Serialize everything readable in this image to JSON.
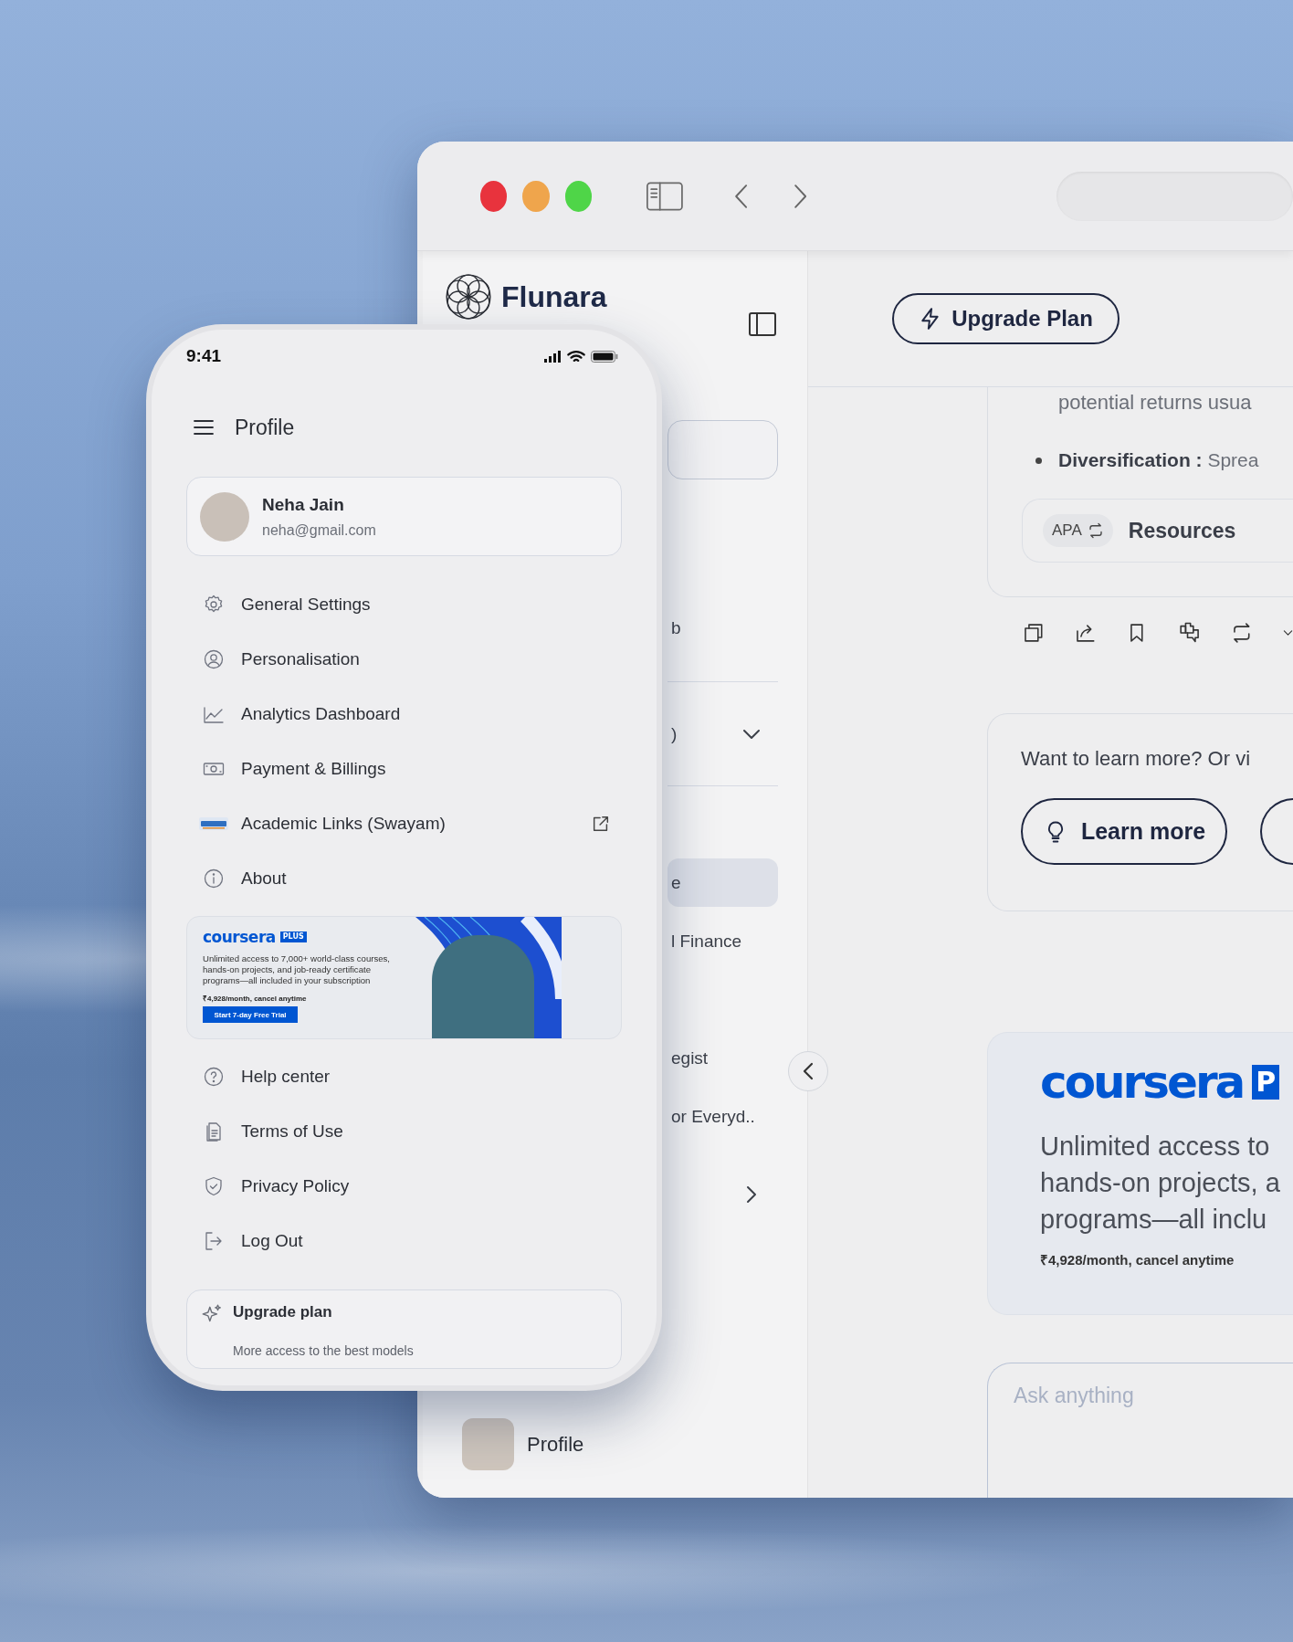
{
  "browser": {
    "sidebar": {
      "logo": "Flunara",
      "items": [
        {
          "kind": "item",
          "label": "b",
          "selected": false
        },
        {
          "kind": "group",
          "label": ")",
          "selected": false
        },
        {
          "kind": "item",
          "label": "e",
          "selected": true
        },
        {
          "kind": "item",
          "label": "l Finance",
          "selected": false
        },
        {
          "kind": "item",
          "label": "egist",
          "selected": false
        },
        {
          "kind": "item",
          "label": "or Everyd..",
          "selected": false
        },
        {
          "kind": "more",
          "selected": false
        }
      ],
      "profile_label": "Profile"
    },
    "header": {
      "upgrade_button": "Upgrade Plan"
    },
    "answer": {
      "fragment": "potential returns usua",
      "bullets": [
        "**Diversification :** Sprea"
      ],
      "citation_style": "APA",
      "resources_label": "Resources"
    },
    "learn_card": {
      "prompt": "Want to learn more? Or vi",
      "button": "Learn more"
    },
    "ad": {
      "brand": "coursera",
      "badge": "P",
      "lines": [
        "Unlimited access to",
        "hands-on projects, a",
        "programs—all inclu"
      ],
      "price": "₹4,928/month, cancel anytime"
    },
    "composer": {
      "placeholder": "Ask anything"
    }
  },
  "phone": {
    "time": "9:41",
    "title": "Profile",
    "user": {
      "name": "Neha Jain",
      "email": "neha@gmail.com"
    },
    "menu": [
      {
        "label": "General Settings",
        "external": false
      },
      {
        "label": "Personalisation",
        "external": false
      },
      {
        "label": "Analytics Dashboard",
        "external": false
      },
      {
        "label": "Payment & Billings",
        "external": false
      },
      {
        "label": "Academic Links (Swayam)",
        "external": true
      },
      {
        "label": "About",
        "external": false
      }
    ],
    "promo": {
      "brand": "coursera",
      "badge": "PLUS",
      "text": "Unlimited access to 7,000+ world-class courses, hands-on projects, and job-ready certificate programs—all included in your subscription",
      "price": "₹4,928/month, cancel anytime",
      "button": "Start 7-day Free Trial"
    },
    "menu2": [
      {
        "label": "Help center",
        "external": false
      },
      {
        "label": "Terms of Use",
        "external": false
      },
      {
        "label": "Privacy Policy",
        "external": false
      },
      {
        "label": "Log Out",
        "external": false
      }
    ],
    "upgrade": {
      "title": "Upgrade plan",
      "subtitle": "More access to the best models"
    }
  }
}
